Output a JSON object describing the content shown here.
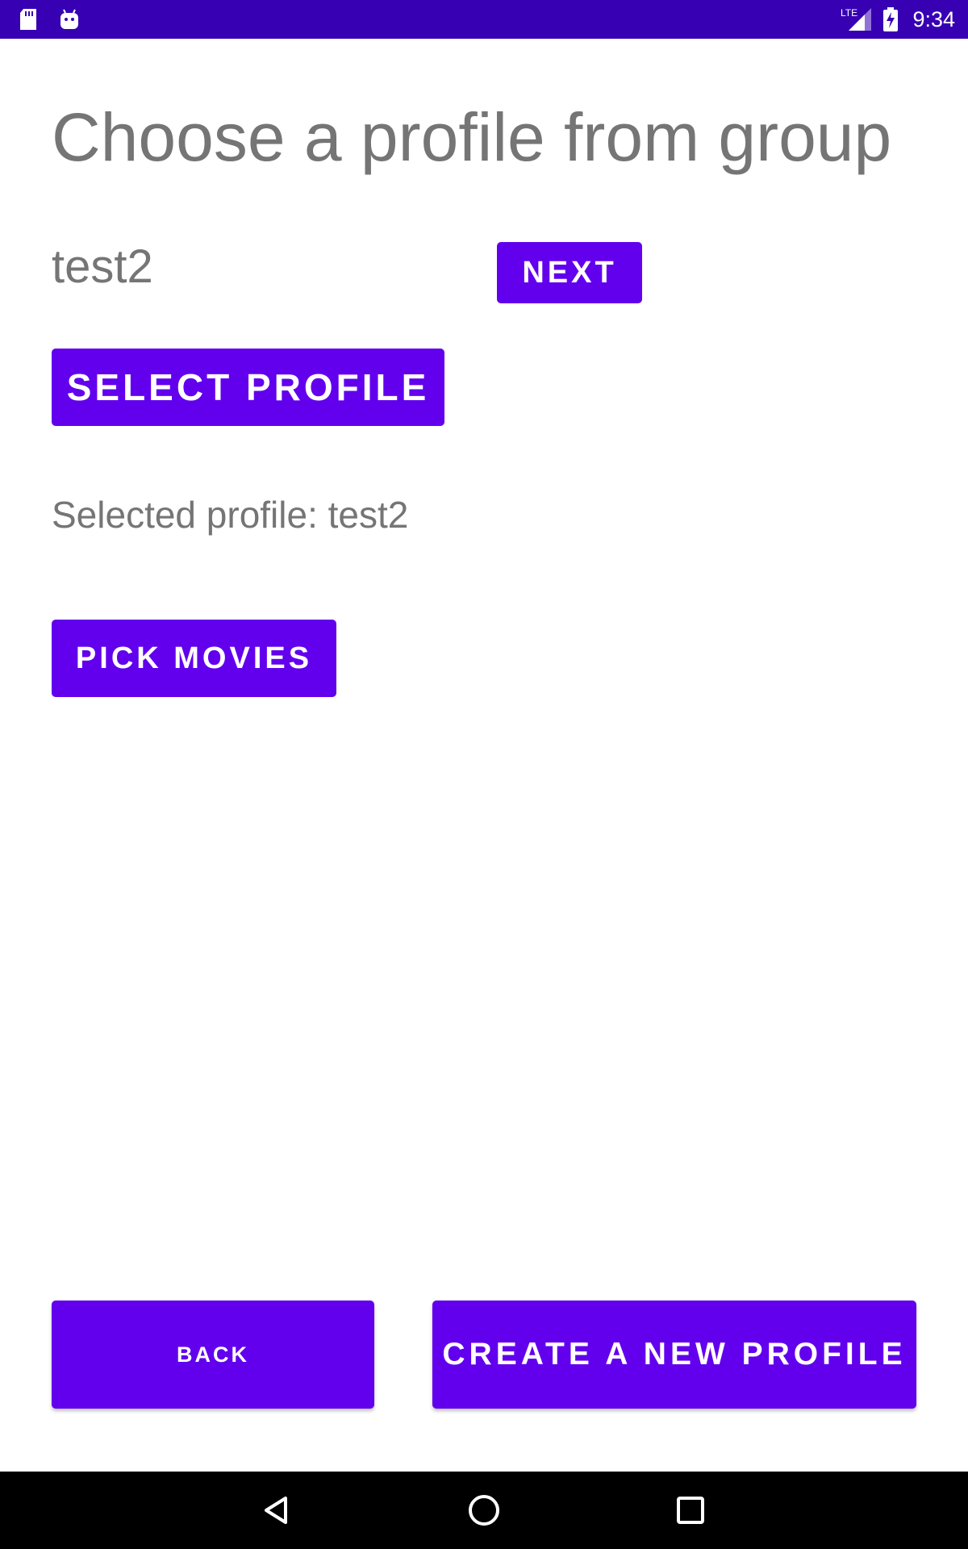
{
  "status_bar": {
    "time": "9:34",
    "network_label": "LTE",
    "left_icons": [
      "sd-card-icon",
      "android-debug-icon"
    ],
    "right_icons": [
      "lte-signal-icon",
      "battery-charging-icon"
    ],
    "background_color": "#3700b3"
  },
  "page": {
    "title": "Choose a profile from group",
    "profile_name": "test2",
    "next_label": "NEXT",
    "select_profile_label": "SELECT PROFILE",
    "selected_profile_text": "Selected profile: test2",
    "pick_movies_label": "PICK MOVIES",
    "back_label": "BACK",
    "create_profile_label": "CREATE A NEW PROFILE"
  },
  "colors": {
    "accent": "#6200ee",
    "text_gray": "#757575"
  },
  "nav_bar": {
    "icons": [
      "back-triangle-icon",
      "home-circle-icon",
      "recents-square-icon"
    ]
  }
}
